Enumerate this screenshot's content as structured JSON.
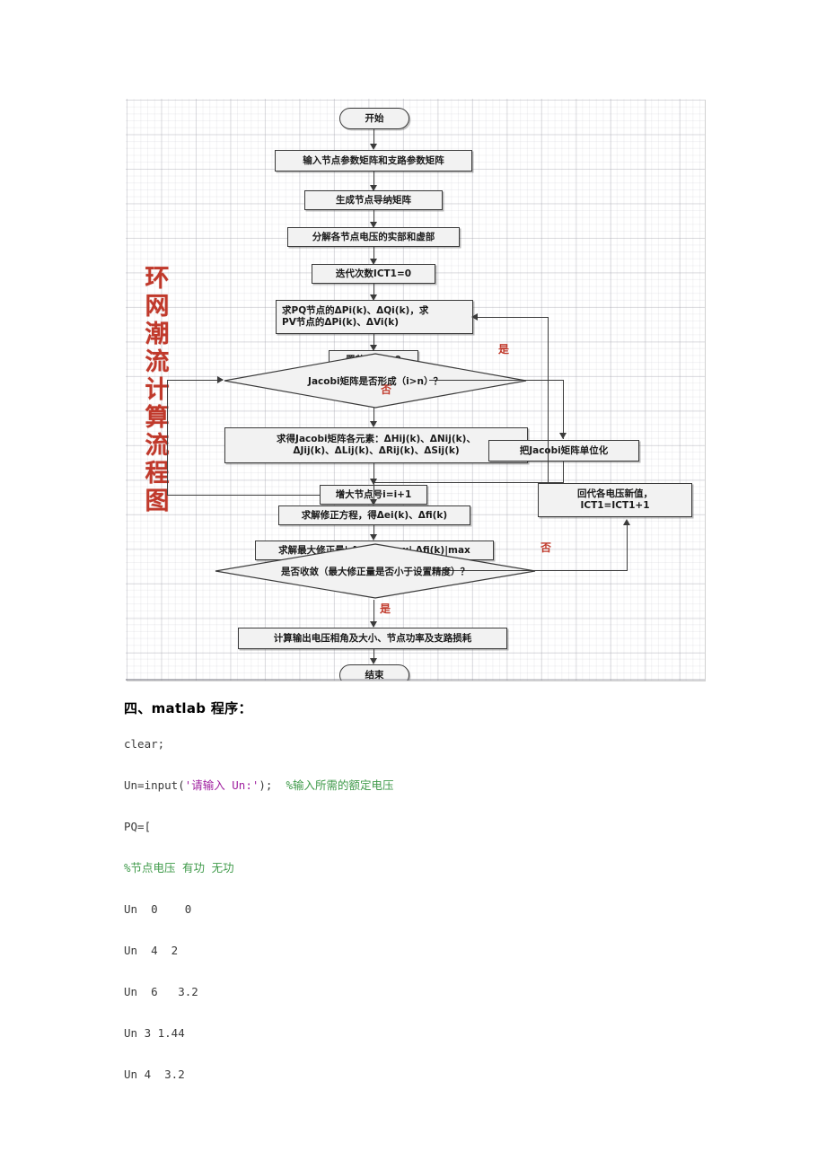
{
  "figure": {
    "title_vertical": "环网潮流计算流程图",
    "title_color": "#c0392b",
    "nodes": {
      "start": "开始",
      "input_matrices": "输入节点参数矩阵和支路参数矩阵",
      "admittance": "生成节点导纳矩阵",
      "decompose": "分解各节点电压的实部和虚部",
      "iter_init": "迭代次数ICT1=0",
      "delta_pq_line1": "求PQ节点的ΔPi(k)、ΔQi(k)，求",
      "delta_pq_line2": "PV节点的ΔPi(k)、ΔVi(k)",
      "set_node": "置节点号i=0",
      "jacobi_check": "Jacobi矩阵是否形成（i>n）？",
      "jacobi_elems_line1": "求得Jacobi矩阵各元素：ΔHij(k)、ΔNij(k)、",
      "jacobi_elems_line2": "ΔJij(k)、ΔLij(k)、ΔRij(k)、ΔSij(k)",
      "inc_node": "增大节点号i=i+1",
      "jacobi_unitize": "把Jacobi矩阵单位化",
      "solve_correction": "求解修正方程，得Δei(k)、Δfi(k)",
      "max_correction": "求解最大修正量| Δei(k)|max| Δfi(k)|max",
      "converge_check": "是否收敛（最大修正量是否小于设置精度）？",
      "back_sub_line1": "回代各电压新值，",
      "back_sub_line2": "ICT1=ICT1+1",
      "output": "计算输出电压相角及大小、节点功率及支路损耗",
      "end": "结束"
    },
    "branch_labels": {
      "jacobi_yes": "是",
      "jacobi_no": "否",
      "converge_no": "否",
      "converge_yes": "是"
    }
  },
  "document": {
    "heading": "四、matlab 程序：",
    "code": {
      "clear": "clear;",
      "un_input_prefix": "Un=input(",
      "un_input_string": "'请输入 Un:'",
      "un_input_suffix": ");",
      "un_input_comment": "%输入所需的额定电压",
      "pq_open": "PQ=[",
      "pq_header_comment": "%节点电压 有功 无功",
      "row1": "Un  0    0",
      "row2": "Un  4  2",
      "row3": "Un  6   3.2",
      "row4": "Un 3 1.44",
      "row5": "Un 4  3.2"
    }
  }
}
